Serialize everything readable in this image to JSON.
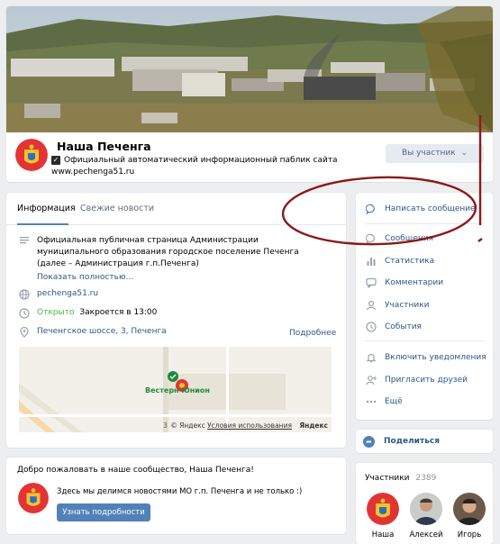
{
  "header": {
    "title": "Наша Печенга",
    "status": "Официальный автоматический информационный паблик сайта",
    "site": "www.pechenga51.ru",
    "member_button": "Вы участник",
    "member_chevron": "⌄"
  },
  "tabs": {
    "info": "Информация",
    "news": "Свежие новости"
  },
  "info": {
    "description": "Официальная публичная страница Администрации муниципального образования городское поселение Печенга (далее – Администрация г.п.Печенга)",
    "more_link": "Показать полностью…",
    "website": "pechenga51.ru",
    "open_status": "Открыто",
    "closes": "Закроется в 13:00",
    "address": "Печенгское шоссе, 3, Печенга",
    "address_more": "Подробнее",
    "map": {
      "place": "Вестерн Юнион",
      "credit": "© Яндекс",
      "terms": "Условия использования",
      "brand": "Яндекс",
      "house_number": "3"
    }
  },
  "welcome": {
    "title": "Добро пожаловать в наше сообщество, Наша Печенга!",
    "text": "Здесь мы делимся новостями МО г.п. Печенга и не только :)",
    "button": "Узнать подробности"
  },
  "menu": {
    "items": [
      {
        "label": "Написать сообщение",
        "icon": "message-icon"
      },
      {
        "label": "Сообщения",
        "icon": "chat-icon"
      },
      {
        "label": "Статистика",
        "icon": "stats-icon"
      },
      {
        "label": "Комментарии",
        "icon": "comments-icon"
      },
      {
        "label": "Участники",
        "icon": "user-icon"
      },
      {
        "label": "События",
        "icon": "event-icon"
      },
      {
        "label": "Включить уведомления",
        "icon": "bell-icon"
      },
      {
        "label": "Пригласить друзей",
        "icon": "invite-icon"
      },
      {
        "label": "Ещё",
        "icon": "more-icon"
      }
    ]
  },
  "share": {
    "label": "Поделиться"
  },
  "members": {
    "title": "Участники",
    "count": "2389",
    "list": [
      {
        "name": "Наша"
      },
      {
        "name": "Алексей"
      },
      {
        "name": "Игорь"
      }
    ]
  },
  "colors": {
    "accent": "#5181b8",
    "link": "#2a5885",
    "open": "#4bb34b",
    "annotation": "#8b1a1a",
    "background": "#edeef0"
  }
}
